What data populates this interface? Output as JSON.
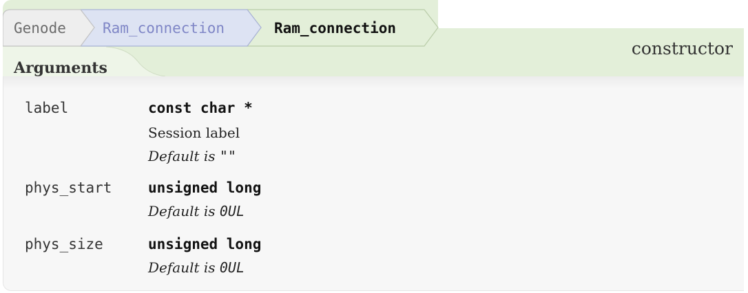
{
  "breadcrumb": {
    "items": [
      "Genode",
      "Ram_connection",
      "Ram_connection"
    ]
  },
  "header": {
    "kind": "constructor"
  },
  "section": {
    "title": "Arguments"
  },
  "arguments": [
    {
      "name": "label",
      "type": "const char *",
      "description": "Session label",
      "default_prefix": "Default is",
      "default_value": "\"\""
    },
    {
      "name": "phys_start",
      "type": "unsigned long",
      "default_prefix": "Default is",
      "default_value": "0UL"
    },
    {
      "name": "phys_size",
      "type": "unsigned long",
      "default_prefix": "Default is",
      "default_value": "0UL"
    }
  ],
  "colors": {
    "band": "#e3efd9",
    "crumb_first": "#eeeeee",
    "crumb_second": "#dde3f3",
    "crumb_third": "#e3efd9"
  }
}
